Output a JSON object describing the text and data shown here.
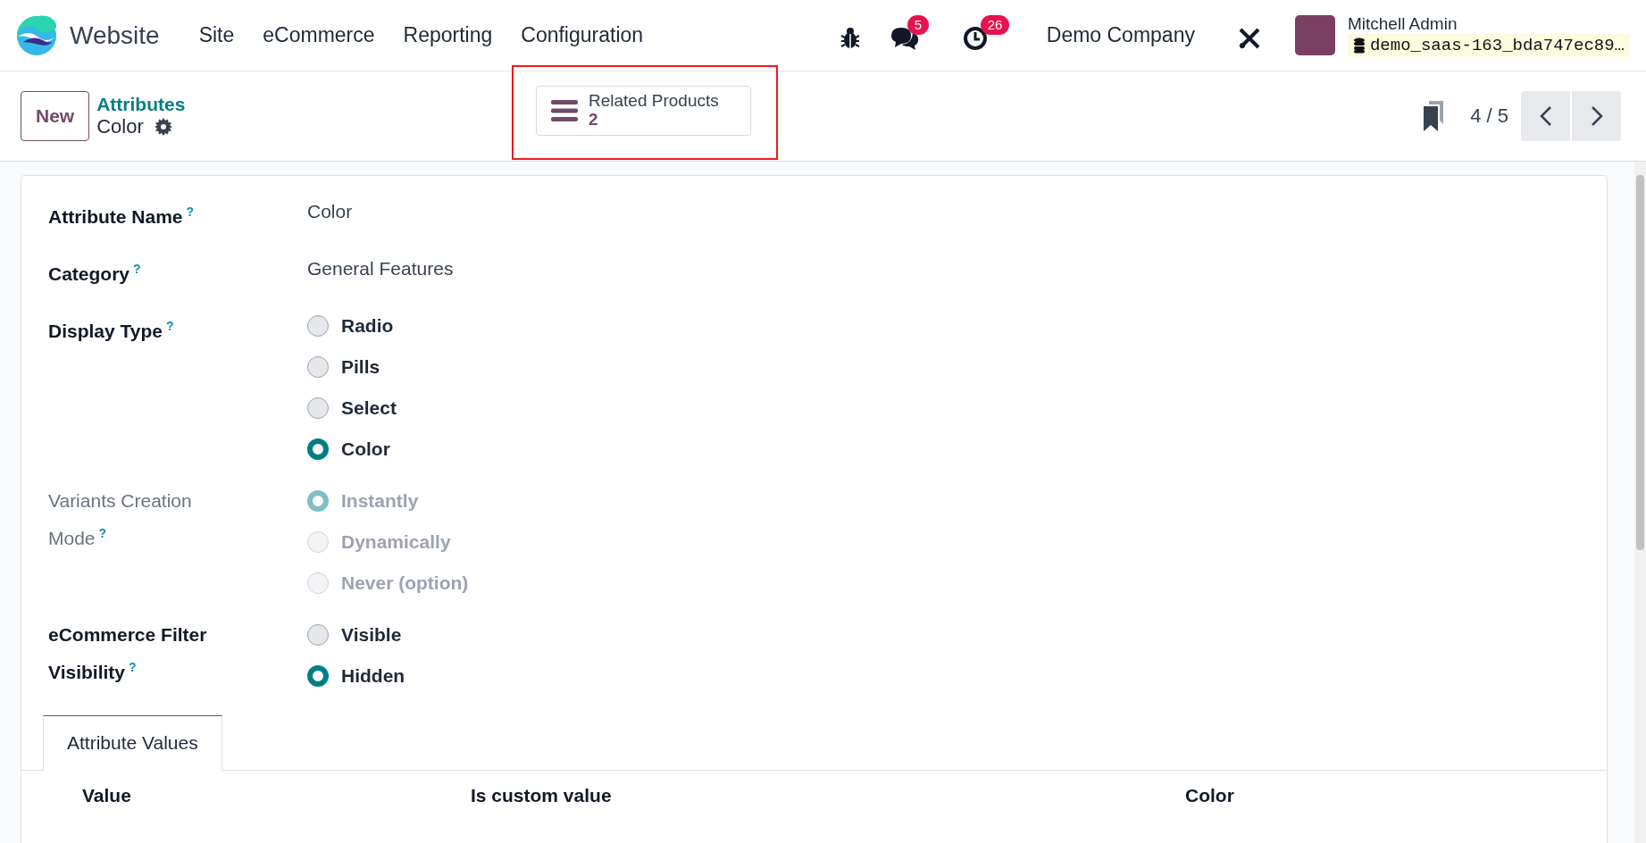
{
  "navbar": {
    "app_name": "Website",
    "menu": [
      "Site",
      "eCommerce",
      "Reporting",
      "Configuration"
    ],
    "messages_count": "5",
    "activities_count": "26",
    "company": "Demo Company",
    "user_name": "Mitchell Admin",
    "database": "demo_saas-163_bda747ec89…"
  },
  "control_panel": {
    "new_button": "New",
    "breadcrumb_parent": "Attributes",
    "breadcrumb_current": "Color",
    "smart_button": {
      "label": "Related Products",
      "count": "2",
      "highlighted": true
    },
    "pager": "4 / 5"
  },
  "form": {
    "fields": [
      {
        "kind": "text",
        "label": "Attribute Name",
        "help": "?",
        "disabled": false,
        "value": "Color"
      },
      {
        "kind": "text",
        "label": "Category",
        "help": "?",
        "disabled": false,
        "value": "General Features"
      },
      {
        "kind": "radio",
        "label": "Display Type",
        "help": "?",
        "disabled": false,
        "options": [
          {
            "label": "Radio",
            "selected": false
          },
          {
            "label": "Pills",
            "selected": false
          },
          {
            "label": "Select",
            "selected": false
          },
          {
            "label": "Color",
            "selected": true
          }
        ]
      },
      {
        "kind": "radio",
        "label": "Variants Creation Mode",
        "help": "?",
        "disabled": true,
        "options": [
          {
            "label": "Instantly",
            "selected": true
          },
          {
            "label": "Dynamically",
            "selected": false
          },
          {
            "label": "Never (option)",
            "selected": false
          }
        ]
      },
      {
        "kind": "radio",
        "label": "eCommerce Filter Visibility",
        "help": "?",
        "disabled": false,
        "options": [
          {
            "label": "Visible",
            "selected": false
          },
          {
            "label": "Hidden",
            "selected": true
          }
        ]
      }
    ],
    "tabs": [
      {
        "label": "Attribute Values",
        "selected": true
      }
    ],
    "table": {
      "columns": [
        "Value",
        "Is custom value",
        "Color"
      ]
    }
  }
}
